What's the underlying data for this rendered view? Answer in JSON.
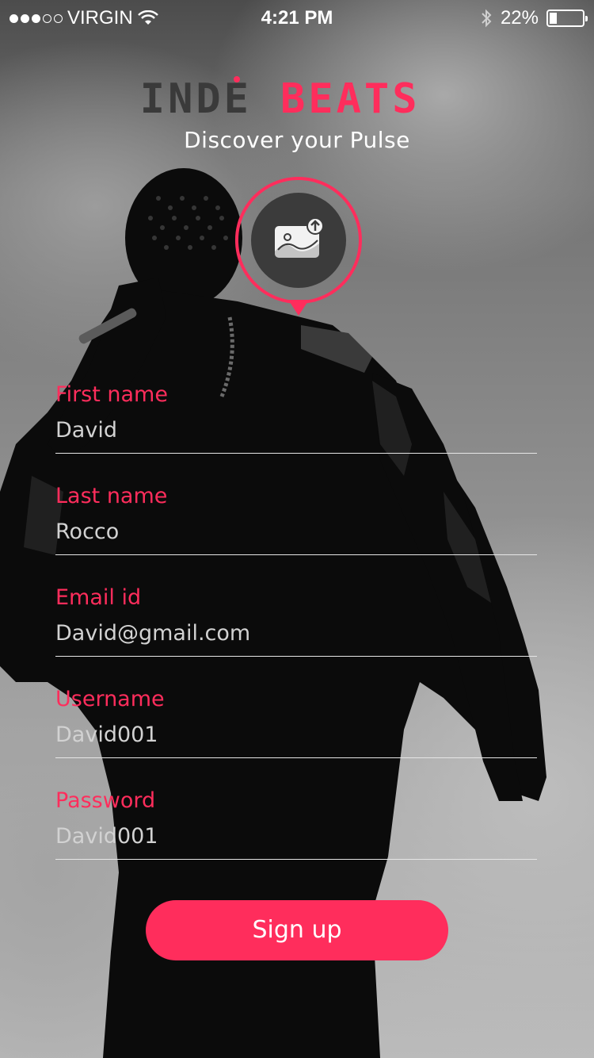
{
  "status_bar": {
    "carrier": "VIRGIN",
    "time": "4:21 PM",
    "battery": "22%",
    "battery_level": 0.22,
    "signal_bars": [
      true,
      true,
      true,
      false,
      false
    ]
  },
  "header": {
    "logo_left": "INDE",
    "logo_right": "BEATS",
    "tagline": "Discover your Pulse"
  },
  "avatar": {
    "icon": "upload-image-icon"
  },
  "form": {
    "fields": [
      {
        "label": "First name",
        "value": "David"
      },
      {
        "label": "Last name",
        "value": "Rocco"
      },
      {
        "label": "Email id",
        "value": "David@gmail.com"
      },
      {
        "label": "Username",
        "value": "David001"
      },
      {
        "label": "Password",
        "value": "David001"
      }
    ],
    "submit_label": "Sign up"
  },
  "colors": {
    "accent": "#ff2d5c",
    "logo_dark": "#3a3a3a"
  }
}
